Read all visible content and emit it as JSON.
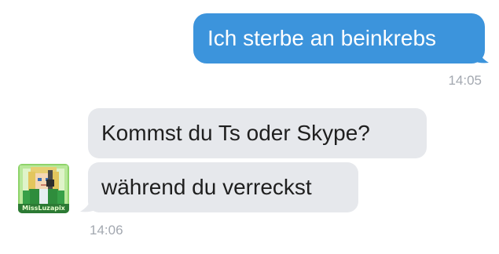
{
  "conversation": {
    "messages": [
      {
        "direction": "outgoing",
        "text": "Ich sterbe an beinkrebs"
      },
      {
        "direction": "incoming",
        "text": "Kommst du Ts oder Skype?"
      },
      {
        "direction": "incoming",
        "text": "während du verreckst"
      }
    ],
    "outgoing_time": "14:05",
    "incoming_time": "14:06",
    "avatar": {
      "icon": "user-avatar-icon",
      "label": "MissLuzapix"
    }
  },
  "colors": {
    "outgoing_bubble": "#3c94dc",
    "incoming_bubble": "#e6e8ec",
    "timestamp": "#a3a8b0"
  }
}
